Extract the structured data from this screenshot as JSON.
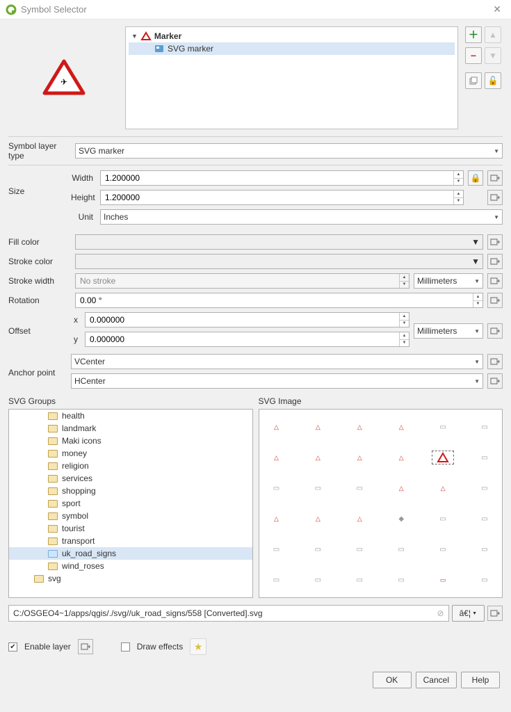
{
  "window": {
    "title": "Symbol Selector"
  },
  "tree": {
    "root_label": "Marker",
    "child_label": "SVG marker"
  },
  "symbol_layer_type": {
    "label": "Symbol layer type",
    "value": "SVG marker"
  },
  "size": {
    "label": "Size",
    "width_label": "Width",
    "width_value": "1.200000",
    "height_label": "Height",
    "height_value": "1.200000",
    "unit_label": "Unit",
    "unit_value": "Inches"
  },
  "fill_color": {
    "label": "Fill color"
  },
  "stroke_color": {
    "label": "Stroke color"
  },
  "stroke_width": {
    "label": "Stroke width",
    "value": "No stroke",
    "unit": "Millimeters"
  },
  "rotation": {
    "label": "Rotation",
    "value": "0.00 °"
  },
  "offset": {
    "label": "Offset",
    "x_label": "x",
    "x_value": "0.000000",
    "y_label": "y",
    "y_value": "0.000000",
    "unit": "Millimeters"
  },
  "anchor": {
    "label": "Anchor point",
    "v_value": "VCenter",
    "h_value": "HCenter"
  },
  "svg_groups": {
    "label": "SVG Groups",
    "items": [
      "health",
      "landmark",
      "Maki icons",
      "money",
      "religion",
      "services",
      "shopping",
      "sport",
      "symbol",
      "tourist",
      "transport",
      "uk_road_signs",
      "wind_roses"
    ],
    "selected": "uk_road_signs",
    "bottom_item": "svg"
  },
  "svg_image": {
    "label": "SVG Image"
  },
  "path": {
    "value": "C:/OSGEO4~1/apps/qgis/./svg//uk_road_signs/558 [Converted].svg",
    "browse": "â€¦"
  },
  "footer": {
    "enable_layer": "Enable layer",
    "draw_effects": "Draw effects"
  },
  "buttons": {
    "ok": "OK",
    "cancel": "Cancel",
    "help": "Help"
  }
}
